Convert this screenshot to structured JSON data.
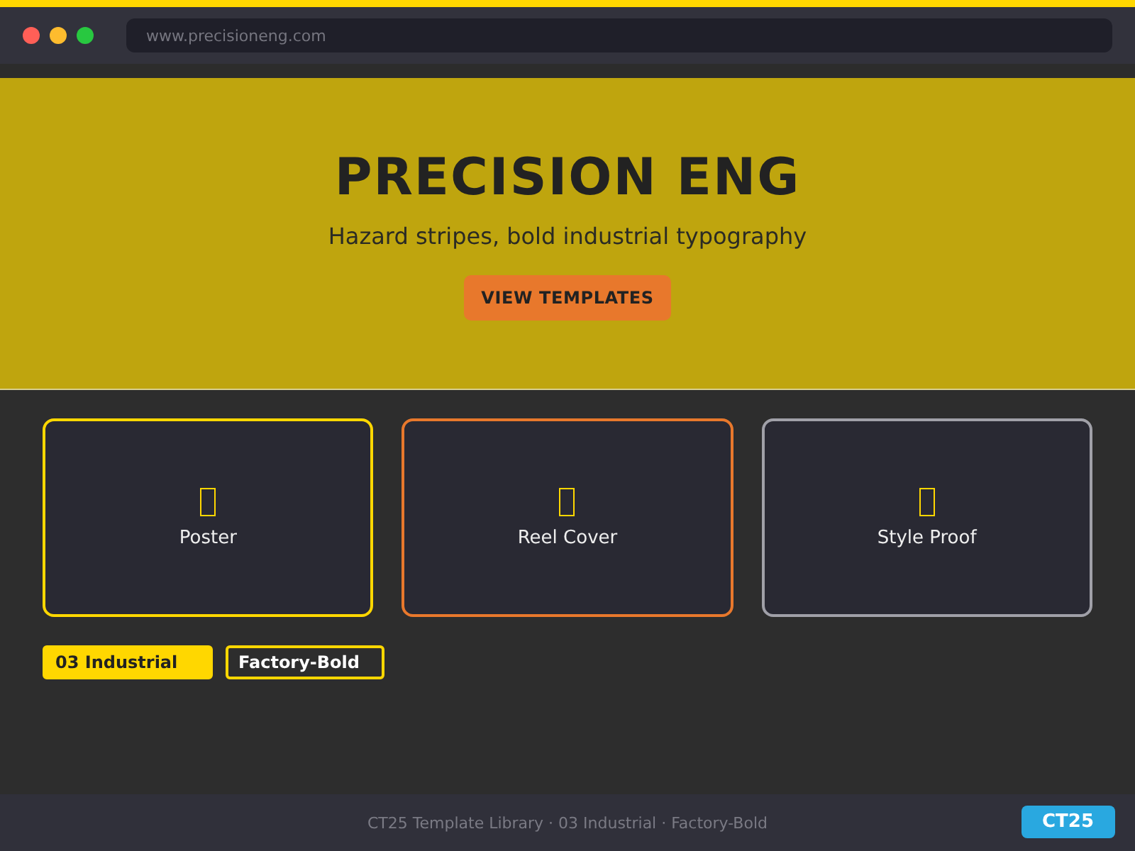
{
  "browser": {
    "url": "www.precisioneng.com"
  },
  "hero": {
    "title": "PRECISION ENG",
    "subtitle": "Hazard stripes, bold industrial typography",
    "button": "VIEW TEMPLATES"
  },
  "cards": [
    {
      "label": "Poster",
      "color": "#ffd700"
    },
    {
      "label": "Reel Cover",
      "color": "#e8782c"
    },
    {
      "label": "Style Proof",
      "color": "#a0a0a8"
    }
  ],
  "tags": [
    {
      "label": "03 Industrial",
      "kind": "filled"
    },
    {
      "label": "Factory-Bold",
      "kind": "outline"
    }
  ],
  "footer": {
    "text": "CT25 Template Library · 03 Industrial · Factory-Bold",
    "badge": "CT25"
  }
}
